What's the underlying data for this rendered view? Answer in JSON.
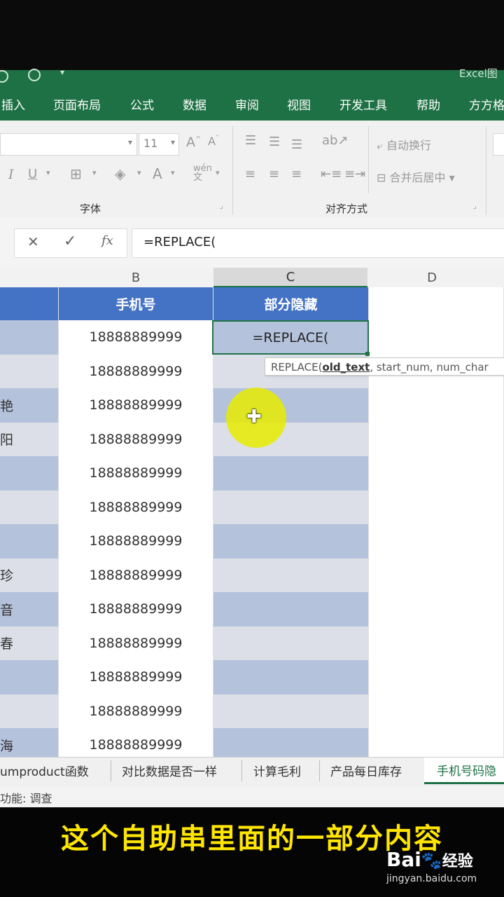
{
  "title_fragment": "Excel图",
  "ribbon_tabs": [
    "插入",
    "页面布局",
    "公式",
    "数据",
    "审阅",
    "视图",
    "开发工具",
    "帮助",
    "方方格"
  ],
  "font_group": {
    "label": "字体",
    "font_size": "11"
  },
  "align_group": {
    "label": "对齐方式",
    "wrap_text": "自动换行",
    "merge_center": "合并后居中"
  },
  "formula_bar": {
    "cancel": "✕",
    "confirm": "✓",
    "fx": "fx",
    "value": "=REPLACE("
  },
  "columns": [
    "B",
    "C",
    "D"
  ],
  "table_headers": {
    "b": "手机号",
    "c": "部分隐藏"
  },
  "phone_values": [
    "18888889999",
    "18888889999",
    "18888889999",
    "18888889999",
    "18888889999",
    "18888889999",
    "18888889999",
    "18888889999",
    "18888889999",
    "18888889999",
    "18888889999",
    "18888889999",
    "18888889999"
  ],
  "left_fragments": [
    "",
    "",
    "艳",
    "阳",
    "",
    "",
    "",
    "珍",
    "音",
    "春",
    "",
    "",
    "海"
  ],
  "active_cell_value": "=REPLACE(",
  "tooltip": {
    "fn": "REPLACE(",
    "arg1": "old_text",
    "rest": ", start_num, num_char"
  },
  "sheet_tabs": [
    "umproduct函数",
    "对比数据是否一样",
    "计算毛利",
    "产品每日库存",
    "手机号码隐"
  ],
  "status_text": "功能: 调查",
  "caption": "这个自助串里面的一部分内容",
  "watermark": {
    "brand": "Bai",
    "brand2": "经验",
    "url": "jingyan.baidu.com"
  }
}
